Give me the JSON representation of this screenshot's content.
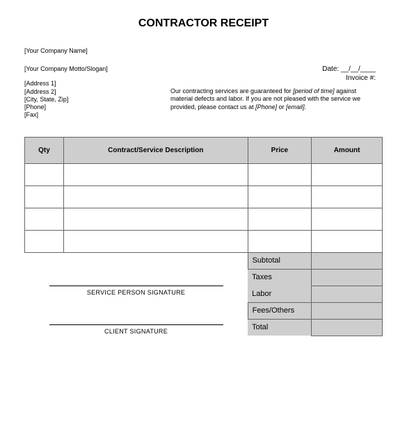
{
  "title": "CONTRACTOR RECEIPT",
  "company": {
    "name": "[Your Company Name]",
    "motto": "[Your Company Motto/Slogan]",
    "address1": "[Address 1]",
    "address2": "[Address 2]",
    "city_state_zip": "[City, State, Zip]",
    "phone": "[Phone]",
    "fax": "[Fax]"
  },
  "meta": {
    "date_label": "Date: __/__/____",
    "invoice_label": "Invoice #:"
  },
  "guarantee": {
    "prefix": "Our contracting services are guaranteed for ",
    "period": "[period of time]",
    "middle": " against material defects and labor. If you are not pleased with the service we provided, please contact us at ",
    "phone": "[Phone]",
    "or": " or ",
    "email": "[email]",
    "suffix": "."
  },
  "table": {
    "headers": {
      "qty": "Qty",
      "desc": "Contract/Service Description",
      "price": "Price",
      "amount": "Amount"
    },
    "rows": [
      "",
      "",
      "",
      ""
    ],
    "summary": {
      "subtotal": "Subtotal",
      "taxes": "Taxes",
      "labor": "Labor",
      "fees": "Fees/Others",
      "total": "Total"
    }
  },
  "signatures": {
    "service": "SERVICE PERSON SIGNATURE",
    "client": "CLIENT SIGNATURE"
  }
}
